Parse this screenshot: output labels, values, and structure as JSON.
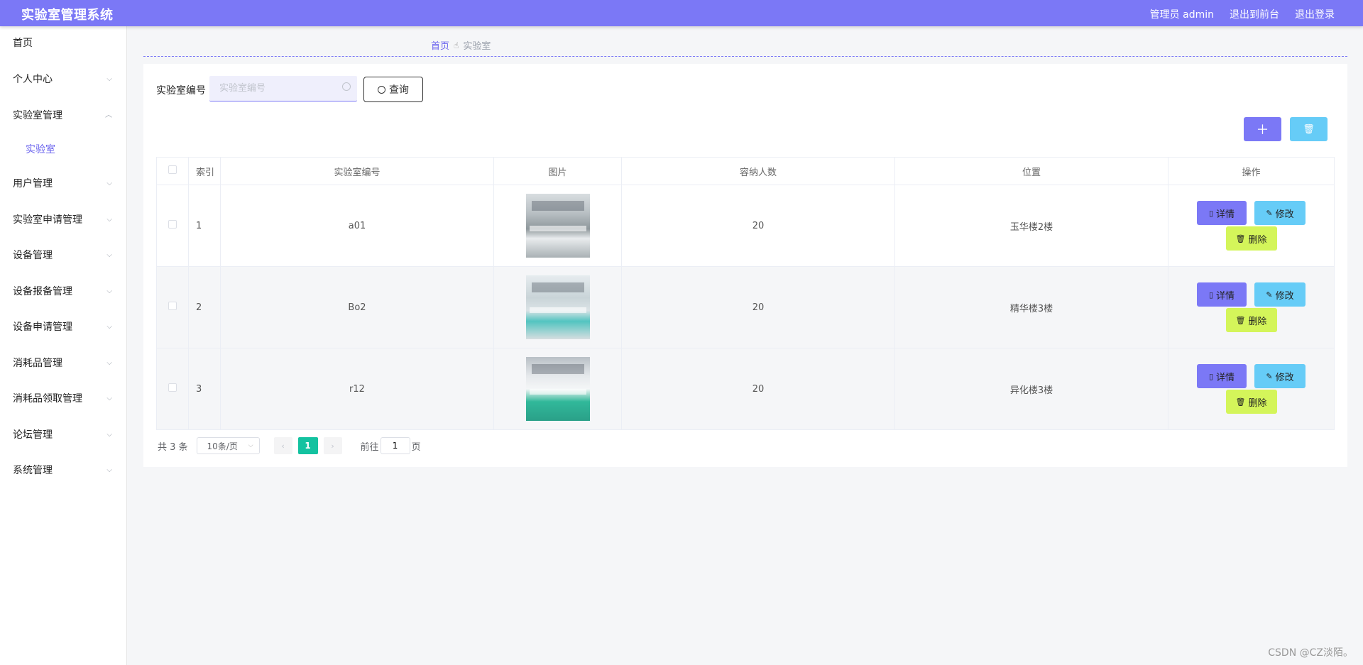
{
  "header": {
    "title": "实验室管理系统",
    "admin_label": "管理员 admin",
    "back_front": "退出到前台",
    "logout": "退出登录"
  },
  "sidebar": {
    "items": [
      {
        "label": "首页",
        "expandable": false
      },
      {
        "label": "个人中心",
        "expandable": true
      },
      {
        "label": "实验室管理",
        "expandable": true,
        "expanded": true
      },
      {
        "label": "实验室",
        "sub": true,
        "active": true
      },
      {
        "label": "用户管理",
        "expandable": true
      },
      {
        "label": "实验室申请管理",
        "expandable": true
      },
      {
        "label": "设备管理",
        "expandable": true
      },
      {
        "label": "设备报备管理",
        "expandable": true
      },
      {
        "label": "设备申请管理",
        "expandable": true
      },
      {
        "label": "消耗品管理",
        "expandable": true
      },
      {
        "label": "消耗品领取管理",
        "expandable": true
      },
      {
        "label": "论坛管理",
        "expandable": true
      },
      {
        "label": "系统管理",
        "expandable": true
      }
    ]
  },
  "breadcrumb": {
    "home": "首页",
    "current": "实验室"
  },
  "search": {
    "label": "实验室编号",
    "placeholder": "实验室编号",
    "value": "",
    "button": "查询"
  },
  "actions": {
    "add_icon": "plus-icon",
    "delete_icon": "trash-icon"
  },
  "table": {
    "columns": [
      "索引",
      "实验室编号",
      "图片",
      "容纳人数",
      "位置",
      "操作"
    ],
    "rows": [
      {
        "index": "1",
        "code": "a01",
        "capacity": "20",
        "location": "玉华楼2楼"
      },
      {
        "index": "2",
        "code": "Bo2",
        "capacity": "20",
        "location": "精华楼3楼"
      },
      {
        "index": "3",
        "code": "r12",
        "capacity": "20",
        "location": "异化楼3楼"
      }
    ],
    "btn_detail": "详情",
    "btn_edit": "修改",
    "btn_delete": "删除"
  },
  "pagination": {
    "total": "共 3 条",
    "page_size": "10条/页",
    "current_page": "1",
    "goto_prefix": "前往",
    "goto_value": "1",
    "goto_suffix": "页"
  },
  "watermark": "CSDN @CZ淡陌。",
  "colors": {
    "brand": "#7b78f6",
    "edit": "#66ccf7",
    "delete": "#d4f55a",
    "page_active": "#13c2a0"
  }
}
